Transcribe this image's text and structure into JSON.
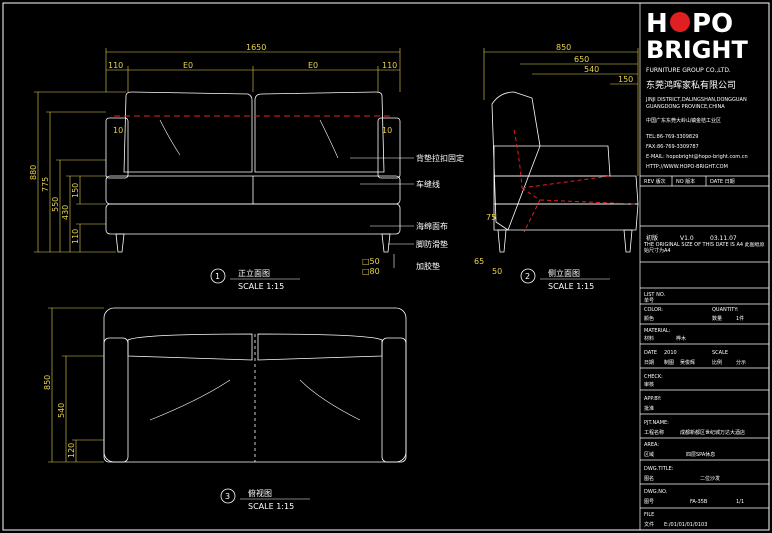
{
  "logo": {
    "word1": "H",
    "o_letter": "O",
    "word1_rest": "PO",
    "word2": "BRIGHT",
    "company_en": "FURNITURE GROUP CO.,LTD.",
    "company_cn": "东莞鸿晖家私有限公司",
    "address_en_1": "JINJI DISTRICT,DALINGSHAN,DONGGUAN",
    "address_en_2": "GUANGDONG PROVINCE,CHINA",
    "address_cn": "中国广东东莞大岭山镇金桔工业区",
    "tel": "TEL:86-769-3309829",
    "fax": "FAX:86-769-3309787",
    "email": "E-MAIL: hopobright@hopo-bright.com.cn",
    "web": "HTTP://WWW.HOPO-BRIGHT.COM"
  },
  "revision": {
    "headers": [
      "REV 版次",
      "NO 版本",
      "DATE 日期"
    ],
    "version_label": "初版",
    "version": "V1.0",
    "date": "03.11.07",
    "note": "THE ORIGINAL SIZE OF THIS DATE IS A4 此图纸原始尺寸为A4"
  },
  "title_block": {
    "list_no_label": "LIST NO.",
    "list_no_cn": "单号",
    "color_label": "COLOR:",
    "color_cn": "颜色",
    "quantity_label": "QUANTITY:",
    "quantity_cn": "数量",
    "quantity_value": "1件",
    "material_label": "MATERIAL:",
    "material_cn": "材料",
    "material_value": "桦木",
    "date_label": "DATE",
    "date_cn": "日期",
    "date_value": "2010",
    "drafter_label": "制图",
    "drafter_value": "吴俊辉",
    "scale_label": "SCALE",
    "scale_cn": "比例",
    "scale_value": "分示",
    "check_label": "CHECK:",
    "check_cn": "审核",
    "appr_label": "APP.BY:",
    "appr_cn": "批准",
    "prj_label": "PJT.NAME:",
    "prj_cn": "工程名称",
    "prj_value": "成都新都区世纪城万达大酒店",
    "area_label": "AREA:",
    "area_cn": "区域",
    "area_value": "四层SPA休息",
    "dwg_title_label": "DWG.TITLE:",
    "dwg_title_cn": "图名",
    "dwg_title_value": "二位沙发",
    "dwg_no_label": "DWG.NO.",
    "dwg_no_cn": "图号",
    "dwg_no_value": "FA-35B",
    "sheet_value": "1/1",
    "file_label": "FILE",
    "file_cn": "文件",
    "file_value": "E:/01/01/01/0103"
  },
  "front_view": {
    "number": "1",
    "title": "正立面图",
    "scale": "SCALE 1:15",
    "dims_top": [
      "1650",
      "110",
      "E0",
      "E0",
      "110"
    ],
    "dims_left": [
      "880",
      "775",
      "550",
      "430",
      "150",
      "110"
    ],
    "dim_inner_left": "10",
    "dim_inner_right": "10"
  },
  "side_view": {
    "number": "2",
    "title": "侧立面图",
    "scale": "SCALE 1:15",
    "dims_top": [
      "850",
      "650",
      "540",
      "150"
    ],
    "dims_bottom": [
      "65",
      "50",
      "75"
    ]
  },
  "plan_view": {
    "number": "3",
    "title": "俯视图",
    "scale": "SCALE 1:15",
    "dims_left": [
      "850",
      "540",
      "120"
    ]
  },
  "callouts": {
    "c1": "背垫拉扣固定",
    "c2": "车缝线",
    "c3": "海绵面布",
    "c4": "脚防滑垫",
    "legs": "加胶垫",
    "leg_a": "□50",
    "leg_b": "□80"
  }
}
